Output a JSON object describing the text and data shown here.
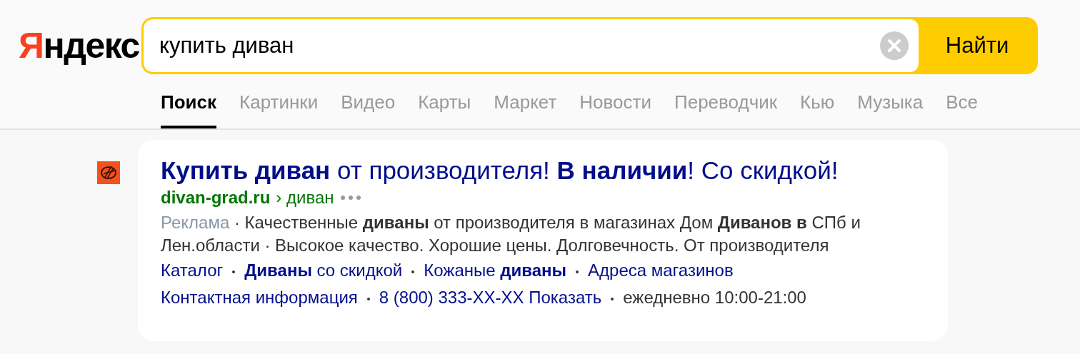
{
  "logo": {
    "text": "Яндекс"
  },
  "search": {
    "value": "купить диван",
    "button": "Найти"
  },
  "tabs": [
    {
      "label": "Поиск",
      "selected": true
    },
    {
      "label": "Картинки",
      "selected": false
    },
    {
      "label": "Видео",
      "selected": false
    },
    {
      "label": "Карты",
      "selected": false
    },
    {
      "label": "Маркет",
      "selected": false
    },
    {
      "label": "Новости",
      "selected": false
    },
    {
      "label": "Переводчик",
      "selected": false
    },
    {
      "label": "Кью",
      "selected": false
    },
    {
      "label": "Музыка",
      "selected": false
    },
    {
      "label": "Все",
      "selected": false
    }
  ],
  "result": {
    "title": "**Купить диван** от производителя! **В наличии**! Со скидкой!",
    "domain": "divan-grad.ru",
    "path": "› диван",
    "ad_label": "Реклама",
    "description": "· Качественные **диваны** от производителя в магазинах Дом **Диванов в** СПб и Лен.области · Высокое качество. Хорошие цены. Долговечность. От производителя",
    "sitelinks": [
      "Каталог",
      "**Диваны** со скидкой",
      "Кожаные **диваны**",
      "Адреса магазинов"
    ],
    "contacts": [
      {
        "kind": "link",
        "text": "Контактная информация"
      },
      {
        "kind": "link",
        "text": "8 (800) 333-XX-XX Показать"
      },
      {
        "kind": "text",
        "text": "ежедневно 10:00-21:00"
      }
    ]
  }
}
